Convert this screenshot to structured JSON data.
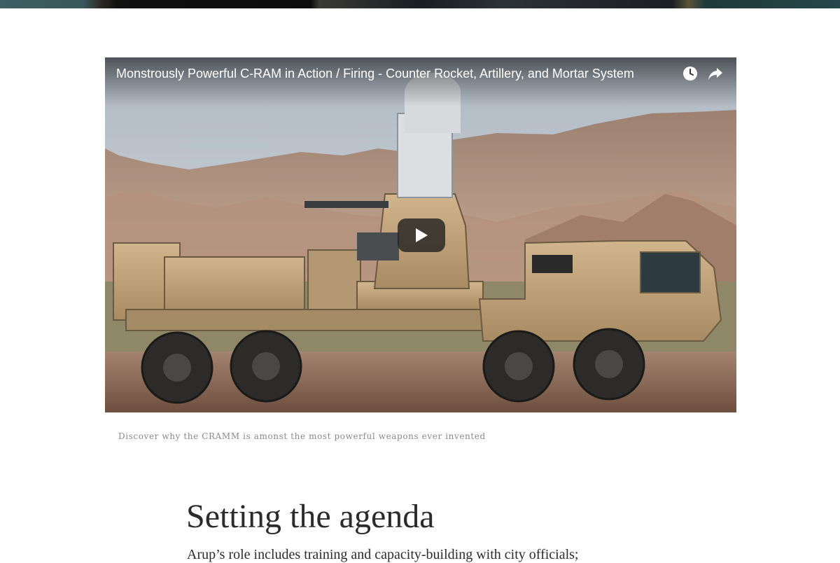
{
  "video": {
    "title": "Monstrously Powerful C-RAM in Action / Firing - Counter Rocket, Artillery, and Mortar System",
    "buttons": {
      "watch_later_icon": "clock-icon",
      "share_icon": "share-arrow-icon",
      "play_icon": "play-icon"
    }
  },
  "caption": "Discover why the CRAMM is amonst the most powerful weapons ever invented",
  "article": {
    "heading": "Setting the agenda",
    "paragraph_start": "Arup’s role includes training and capacity-building with city officials;"
  },
  "colors": {
    "vehicle_tan": "#c4a57a",
    "sky": "#c9d0d8",
    "mountains": "#b08f7c",
    "ground": "#8a6a56"
  }
}
